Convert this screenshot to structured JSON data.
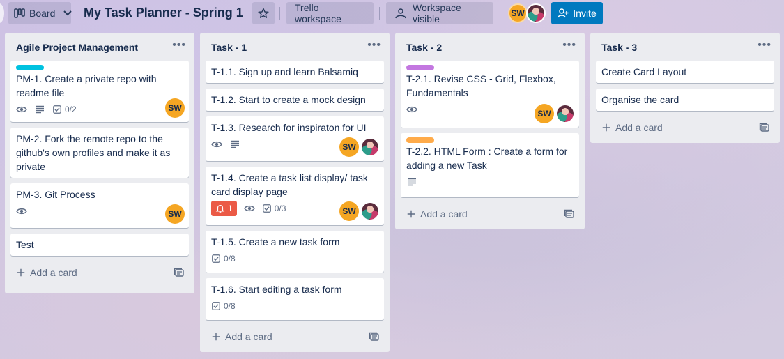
{
  "header": {
    "board_view_label": "Board",
    "board_title": "My Task Planner - Spring 1",
    "workspace_label": "Trello workspace",
    "visibility_label": "Workspace visible",
    "invite_label": "Invite",
    "members": [
      {
        "initials": "SW"
      },
      {
        "initials": ""
      }
    ]
  },
  "colors": {
    "accent": "#0079bf",
    "label_cyan": "#00c2e0",
    "label_purple": "#c377e0",
    "label_orange": "#ffab4a",
    "notification_red": "#eb5a46",
    "avatar_orange": "#f5a623"
  },
  "lists": [
    {
      "title": "Agile Project Management",
      "cards": [
        {
          "title": "PM-1. Create a private repo with readme file",
          "checklist": "0/2"
        },
        {
          "title": "PM-2. Fork the remote repo to the github's own profiles and make it as private"
        },
        {
          "title": "PM-3. Git Process"
        },
        {
          "title": "Test"
        }
      ],
      "add_card_label": "Add a card"
    },
    {
      "title": "Task - 1",
      "cards": [
        {
          "title": "T-1.1. Sign up and learn Balsamiq"
        },
        {
          "title": "T-1.2. Start to create a mock design"
        },
        {
          "title": "T-1.3. Research for inspiraton for UI"
        },
        {
          "title": "T-1.4. Create a task list display/ task card display page",
          "notifications": "1",
          "checklist": "0/3"
        },
        {
          "title": "T-1.5. Create a new task form",
          "checklist": "0/8"
        },
        {
          "title": "T-1.6. Start editing a task form",
          "checklist": "0/8"
        }
      ],
      "add_card_label": "Add a card"
    },
    {
      "title": "Task - 2",
      "cards": [
        {
          "title": "T-2.1. Revise CSS - Grid, Flexbox, Fundamentals"
        },
        {
          "title": "T-2.2. HTML Form : Create a form for adding a new Task"
        }
      ],
      "add_card_label": "Add a card"
    },
    {
      "title": "Task - 3",
      "cards": [
        {
          "title": "Create Card Layout"
        },
        {
          "title": "Organise the card"
        }
      ],
      "add_card_label": "Add a card"
    }
  ]
}
